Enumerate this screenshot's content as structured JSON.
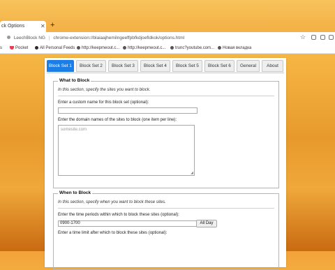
{
  "browser": {
    "tab_title": "ck Options",
    "new_tab_label": "+",
    "address": {
      "site": "LeechBlock NG",
      "separator": "|",
      "url": "chrome-extension://blaiaajhemilngeeffpbfkdjoefldkok/options.html"
    },
    "bookmarks": [
      {
        "label": "s"
      },
      {
        "label": "Pocket"
      },
      {
        "label": "All Personal Feeds"
      },
      {
        "label": "http://keepmeout.c..."
      },
      {
        "label": "http://keepmeout.c..."
      },
      {
        "label": "trunc?youtube.com..."
      },
      {
        "label": "Новая вкладка"
      }
    ]
  },
  "options": {
    "tabs": [
      "Block Set 1",
      "Block Set 2",
      "Block Set 3",
      "Block Set 4",
      "Block Set 5",
      "Block Set 6",
      "General",
      "About"
    ],
    "active_tab": "Block Set 1",
    "what_section": {
      "legend": "What to Block",
      "hint": "In this section, specify the sites you want to block.",
      "name_label": "Enter a custom name for this block set (optional):",
      "name_value": "",
      "sites_label": "Enter the domain names of the sites to block (one item per line):",
      "sites_placeholder": "somesite.com"
    },
    "when_section": {
      "legend": "When to Block",
      "hint": "In this section, specify when you want to block these sites.",
      "periods_label": "Enter the time periods within which to block these sites (optional):",
      "periods_value": "0900-1700",
      "all_day_button": "All Day",
      "limit_label": "Enter a time limit after which to block these sites (optional):"
    }
  }
}
